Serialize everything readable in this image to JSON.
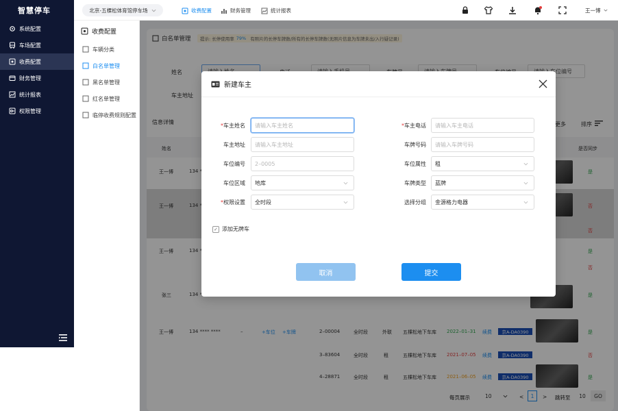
{
  "app": {
    "title": "智慧停车",
    "user": "王一博"
  },
  "sidebar": {
    "items": [
      {
        "label": "系统配置",
        "icon": "gear-icon"
      },
      {
        "label": "车场配置",
        "icon": "bus-icon"
      },
      {
        "label": "收费配置",
        "icon": "fee-icon",
        "active": true
      },
      {
        "label": "财务管理",
        "icon": "wallet-icon"
      },
      {
        "label": "统计报表",
        "icon": "chart-icon"
      },
      {
        "label": "权限管理",
        "icon": "key-icon"
      }
    ]
  },
  "submenu": {
    "title": "收费配置",
    "items": [
      {
        "label": "车辆分类"
      },
      {
        "label": "白名单管理",
        "active": true
      },
      {
        "label": "黑名单管理"
      },
      {
        "label": "红名单管理"
      },
      {
        "label": "临停收费规则配置"
      }
    ]
  },
  "topbar": {
    "parking": "北京-五棵松体育馆停车场",
    "nav": [
      "收费配置",
      "财务管理",
      "统计报表"
    ]
  },
  "page": {
    "title": "白名单管理",
    "tip_prefix": "提示: 长停使用率",
    "tip_rate": "79%",
    "tip_suffix": "有照片的长停车牌数/所有的长停车牌数(无照片信息为车牌未出/入行疑记录)",
    "filters": {
      "name_label": "姓名",
      "name_ph": "请输入姓名",
      "phone_label": "电话",
      "phone_ph": "请输入手机号",
      "plate_label": "车牌号",
      "plate_ph": "请输入车牌号",
      "space_label": "车位编号",
      "space_ph": "请输入车位编号",
      "addr_label": "车主地址"
    },
    "info_label": "信息详情",
    "more_label": "更多",
    "sort_label": "排序",
    "col_name": "姓名",
    "col_sync": "是否同步"
  },
  "rows": [
    {
      "name": "王一博",
      "phone": "134 *",
      "sync": [
        "是"
      ]
    },
    {
      "name": "王一博",
      "phone": "134 *",
      "sync": [
        "否",
        "否"
      ]
    },
    {
      "name": "王一博",
      "phone": "134 *",
      "sync": [
        "是",
        "否"
      ]
    },
    {
      "name": "张三",
      "phone": "134 *",
      "sync": [
        "是"
      ]
    },
    {
      "name": "王一博",
      "phone": "134 **** ****",
      "dash": "–",
      "add_space": "+车位",
      "add_plate": "+车牌",
      "subs": [
        {
          "space": "2–00004",
          "time": "全时段",
          "attr": "外联",
          "area": "五棵松地下车库",
          "date": "2022–01–31",
          "renew": "续费",
          "plate": "京A-DA0390",
          "sync": "是"
        },
        {
          "space": "3–83604",
          "time": "全时段",
          "attr": "租",
          "area": "五棵松地下车库",
          "date": "2021–07–05",
          "renew": "续费",
          "plate": "京A-DA0390",
          "sync": "否"
        },
        {
          "space": "4–28871",
          "time": "全时段",
          "attr": "租",
          "area": "五棵松地下车库",
          "date": "2021–06–05",
          "renew": "续费",
          "plate": "京A-DA0390",
          "sync": "是"
        }
      ]
    }
  ],
  "pager": {
    "per_page_label": "每页展示",
    "per_page": "10",
    "current": "1",
    "jump_label": "跳转至",
    "jump_value": "10",
    "go": "GO"
  },
  "modal": {
    "title": "新建车主",
    "fields": {
      "owner_name": {
        "label": "车主姓名",
        "placeholder": "请输入车主姓名"
      },
      "owner_phone": {
        "label": "车主电话",
        "placeholder": "请输入车主电话"
      },
      "owner_addr": {
        "label": "车主地址",
        "placeholder": "请输入车主地址"
      },
      "plate_no": {
        "label": "车牌号码",
        "placeholder": "请输入车牌号码"
      },
      "space_no": {
        "label": "车位编号",
        "value": "2–0005"
      },
      "space_attr": {
        "label": "车位属性",
        "value": "租"
      },
      "space_area": {
        "label": "车位区域",
        "value": "地库"
      },
      "plate_type": {
        "label": "车牌类型",
        "value": "蓝牌"
      },
      "permission": {
        "label": "权限设置",
        "value": "全时段"
      },
      "group": {
        "label": "选择分组",
        "value": "金源格力电器"
      }
    },
    "no_plate": "添加无牌车",
    "cancel": "取消",
    "submit": "提交"
  },
  "colors": {
    "accent": "#1c8ef0",
    "sidebar": "#0f1733",
    "green": "#2fa84f",
    "red": "#e23c3c",
    "orange": "#f0a020"
  }
}
